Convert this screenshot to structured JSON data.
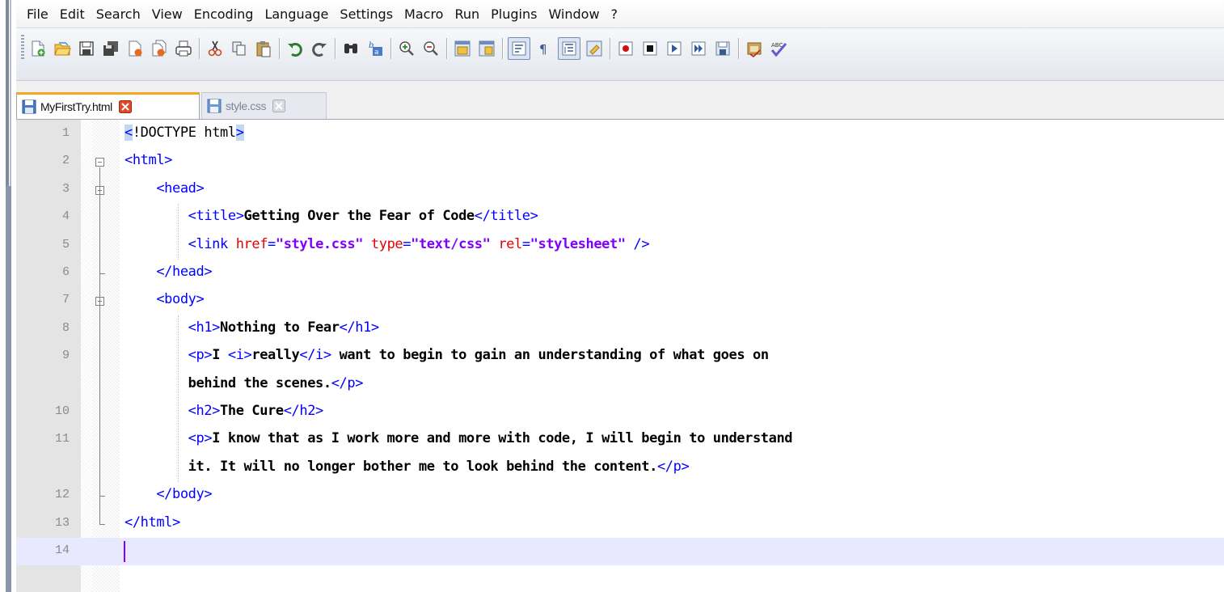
{
  "menu": [
    "File",
    "Edit",
    "Search",
    "View",
    "Encoding",
    "Language",
    "Settings",
    "Macro",
    "Run",
    "Plugins",
    "Window",
    "?"
  ],
  "toolbar_icons": [
    "new-file-icon",
    "open-file-icon",
    "save-icon",
    "save-all-icon",
    "close-icon",
    "close-all-icon",
    "print-icon",
    "cut-icon",
    "copy-icon",
    "paste-icon",
    "undo-icon",
    "redo-icon",
    "find-icon",
    "replace-icon",
    "zoom-in-icon",
    "zoom-out-icon",
    "sync-vertical-icon",
    "sync-horizontal-icon",
    "word-wrap-icon",
    "show-all-chars-icon",
    "indent-guide-icon",
    "user-lang-icon",
    "record-macro-icon",
    "stop-macro-icon",
    "play-macro-icon",
    "run-multiple-macro-icon",
    "save-macro-icon",
    "spell-check-icon",
    "abc-spell-icon"
  ],
  "tabs": [
    {
      "label": "MyFirstTry.html",
      "active": true
    },
    {
      "label": "style.css",
      "active": false
    }
  ],
  "colors": {
    "tag": "#0000ff",
    "attribute": "#e60000",
    "string": "#8000ff",
    "text": "#000000",
    "current_line": "#e8e8ff",
    "tab_accent": "#f5a623"
  },
  "editor": {
    "lines": [
      {
        "num": "1",
        "segments": [
          {
            "t": "<",
            "c": "tag hl"
          },
          {
            "t": "!DOCTYPE html",
            "c": ""
          },
          {
            "t": ">",
            "c": "tag hl"
          }
        ]
      },
      {
        "num": "2",
        "segments": [
          {
            "t": "<html>",
            "c": "tag"
          }
        ]
      },
      {
        "num": "3",
        "segments": [
          {
            "t": "    <head>",
            "c": "tag"
          }
        ]
      },
      {
        "num": "4",
        "segments": [
          {
            "t": "        <title>",
            "c": "tag"
          },
          {
            "t": "Getting Over the Fear of Code",
            "c": "txt"
          },
          {
            "t": "</title>",
            "c": "tag"
          }
        ]
      },
      {
        "num": "5",
        "segments": [
          {
            "t": "        <link ",
            "c": "tag"
          },
          {
            "t": "href",
            "c": "attr"
          },
          {
            "t": "=",
            "c": "tag"
          },
          {
            "t": "\"style.css\"",
            "c": "str"
          },
          {
            "t": " ",
            "c": ""
          },
          {
            "t": "type",
            "c": "attr"
          },
          {
            "t": "=",
            "c": "tag"
          },
          {
            "t": "\"text/css\"",
            "c": "str"
          },
          {
            "t": " ",
            "c": ""
          },
          {
            "t": "rel",
            "c": "attr"
          },
          {
            "t": "=",
            "c": "tag"
          },
          {
            "t": "\"stylesheet\"",
            "c": "str"
          },
          {
            "t": " />",
            "c": "tag"
          }
        ]
      },
      {
        "num": "6",
        "segments": [
          {
            "t": "    </head>",
            "c": "tag"
          }
        ]
      },
      {
        "num": "7",
        "segments": [
          {
            "t": "    <body>",
            "c": "tag"
          }
        ]
      },
      {
        "num": "8",
        "segments": [
          {
            "t": "        <h1>",
            "c": "tag"
          },
          {
            "t": "Nothing to Fear",
            "c": "txt"
          },
          {
            "t": "</h1>",
            "c": "tag"
          }
        ]
      },
      {
        "num": "9",
        "segments": [
          {
            "t": "        <p>",
            "c": "tag"
          },
          {
            "t": "I ",
            "c": "txt"
          },
          {
            "t": "<i>",
            "c": "tag"
          },
          {
            "t": "really",
            "c": "txt"
          },
          {
            "t": "</i>",
            "c": "tag"
          },
          {
            "t": " want to begin to gain an understanding of what goes on",
            "c": "txt"
          }
        ]
      },
      {
        "num": "",
        "segments": [
          {
            "t": "        behind the scenes.",
            "c": "txt"
          },
          {
            "t": "</p>",
            "c": "tag"
          }
        ]
      },
      {
        "num": "10",
        "segments": [
          {
            "t": "        <h2>",
            "c": "tag"
          },
          {
            "t": "The Cure",
            "c": "txt"
          },
          {
            "t": "</h2>",
            "c": "tag"
          }
        ]
      },
      {
        "num": "11",
        "segments": [
          {
            "t": "        <p>",
            "c": "tag"
          },
          {
            "t": "I know that as I work more and more with code, I will begin to understand",
            "c": "txt"
          }
        ]
      },
      {
        "num": "",
        "segments": [
          {
            "t": "        it. It will no longer bother me to look behind the content.",
            "c": "txt"
          },
          {
            "t": "</p>",
            "c": "tag"
          }
        ]
      },
      {
        "num": "12",
        "segments": [
          {
            "t": "    </body>",
            "c": "tag"
          }
        ]
      },
      {
        "num": "13",
        "segments": [
          {
            "t": "</html>",
            "c": "tag"
          }
        ]
      },
      {
        "num": "14",
        "segments": [],
        "current": true
      }
    ]
  }
}
